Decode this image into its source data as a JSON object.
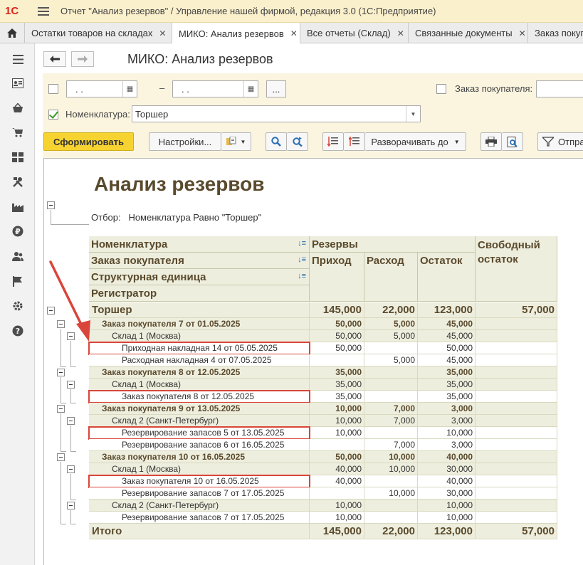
{
  "window": {
    "title": "Отчет \"Анализ резервов\" / Управление нашей фирмой, редакция 3.0  (1С:Предприятие)"
  },
  "tabs": [
    {
      "label": "Остатки товаров на складах",
      "closable": true
    },
    {
      "label": "МИКО: Анализ резервов",
      "closable": true,
      "active": true
    },
    {
      "label": "Все отчеты (Склад)",
      "closable": true
    },
    {
      "label": "Связанные документы",
      "closable": true
    },
    {
      "label": "Заказ покупа",
      "closable": false
    }
  ],
  "form": {
    "title": "МИКО: Анализ резервов"
  },
  "filters": {
    "date_from": ". .",
    "date_sep": "–",
    "date_to": ". .",
    "period_button": "...",
    "order_label": "Заказ покупателя:",
    "order_value": "",
    "nomenclature_label": "Номенклатура:",
    "nomenclature_value": "Торшер",
    "nomenclature_checked": true
  },
  "toolbar": {
    "generate": "Сформировать",
    "settings": "Настройки...",
    "expand_to": "Разворачивать до",
    "send": "Отпра"
  },
  "report": {
    "title": "Анализ резервов",
    "filter_label": "Отбор:",
    "filter_text": "Номенклатура Равно \"Торшер\"",
    "headers": {
      "groupings": [
        "Номенклатура",
        "Заказ покупателя",
        "Структурная единица",
        "Регистратор"
      ],
      "reserves": "Резервы",
      "income": "Приход",
      "expense": "Расход",
      "balance": "Остаток",
      "free_line1": "Свободный",
      "free_line2": "остаток"
    },
    "rows": [
      {
        "level": 0,
        "name": "Торшер",
        "income": "145,000",
        "expense": "22,000",
        "balance": "123,000",
        "free": "57,000"
      },
      {
        "level": 1,
        "name": "Заказ покупателя 7 от 01.05.2025",
        "income": "50,000",
        "expense": "5,000",
        "balance": "45,000",
        "free": ""
      },
      {
        "level": 2,
        "name": "Склад 1 (Москва)",
        "income": "50,000",
        "expense": "5,000",
        "balance": "45,000",
        "free": ""
      },
      {
        "level": 3,
        "name": "Приходная накладная 14 от 05.05.2025",
        "income": "50,000",
        "expense": "",
        "balance": "50,000",
        "free": "",
        "highlight": true
      },
      {
        "level": 3,
        "name": "Расходная накладная 4 от 07.05.2025",
        "income": "",
        "expense": "5,000",
        "balance": "45,000",
        "free": ""
      },
      {
        "level": 1,
        "name": "Заказ покупателя 8 от 12.05.2025",
        "income": "35,000",
        "expense": "",
        "balance": "35,000",
        "free": ""
      },
      {
        "level": 2,
        "name": "Склад 1 (Москва)",
        "income": "35,000",
        "expense": "",
        "balance": "35,000",
        "free": ""
      },
      {
        "level": 3,
        "name": "Заказ покупателя 8 от 12.05.2025",
        "income": "35,000",
        "expense": "",
        "balance": "35,000",
        "free": "",
        "highlight": true
      },
      {
        "level": 1,
        "name": "Заказ покупателя 9 от 13.05.2025",
        "income": "10,000",
        "expense": "7,000",
        "balance": "3,000",
        "free": ""
      },
      {
        "level": 2,
        "name": "Склад 2 (Санкт-Петербург)",
        "income": "10,000",
        "expense": "7,000",
        "balance": "3,000",
        "free": ""
      },
      {
        "level": 3,
        "name": "Резервирование запасов 5 от 13.05.2025",
        "income": "10,000",
        "expense": "",
        "balance": "10,000",
        "free": "",
        "highlight": true
      },
      {
        "level": 3,
        "name": "Резервирование запасов 6 от 16.05.2025",
        "income": "",
        "expense": "7,000",
        "balance": "3,000",
        "free": ""
      },
      {
        "level": 1,
        "name": "Заказ покупателя 10 от 16.05.2025",
        "income": "50,000",
        "expense": "10,000",
        "balance": "40,000",
        "free": ""
      },
      {
        "level": 2,
        "name": "Склад 1 (Москва)",
        "income": "40,000",
        "expense": "10,000",
        "balance": "30,000",
        "free": ""
      },
      {
        "level": 3,
        "name": "Заказ покупателя 10 от 16.05.2025",
        "income": "40,000",
        "expense": "",
        "balance": "40,000",
        "free": "",
        "highlight": true
      },
      {
        "level": 3,
        "name": "Резервирование запасов 7 от 17.05.2025",
        "income": "",
        "expense": "10,000",
        "balance": "30,000",
        "free": ""
      },
      {
        "level": 2,
        "name": "Склад 2 (Санкт-Петербург)",
        "income": "10,000",
        "expense": "",
        "balance": "10,000",
        "free": ""
      },
      {
        "level": 3,
        "name": "Резервирование запасов 7 от 17.05.2025",
        "income": "10,000",
        "expense": "",
        "balance": "10,000",
        "free": ""
      }
    ],
    "total": {
      "name": "Итого",
      "income": "145,000",
      "expense": "22,000",
      "balance": "123,000",
      "free": "57,000"
    }
  },
  "colors": {
    "accent_yellow": "#f7d331",
    "header_bg": "#eeeede",
    "highlight_red": "#d9453a",
    "title_brown": "#5a4a2d"
  },
  "icons": [
    "home-icon",
    "menu-icon",
    "back-arrow-icon",
    "forward-arrow-icon",
    "calendar-icon",
    "search-icon",
    "print-icon",
    "preview-icon",
    "send-icon"
  ]
}
